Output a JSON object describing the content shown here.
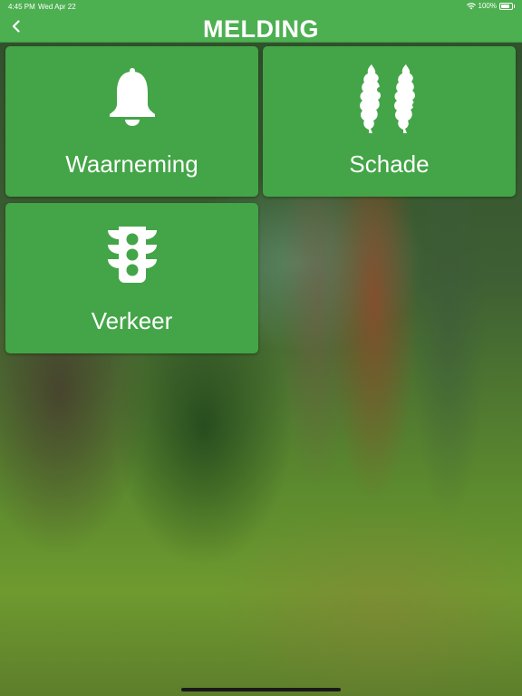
{
  "status_bar": {
    "time": "4:45 PM",
    "date": "Wed Apr 22",
    "battery": "100%",
    "battery_level": 1.0
  },
  "nav": {
    "title": "MELDING",
    "back_icon": "chevron-left-icon"
  },
  "tiles": [
    {
      "label": "Waarneming",
      "icon": "bell-icon"
    },
    {
      "label": "Schade",
      "icon": "damaged-trees-icon"
    },
    {
      "label": "Verkeer",
      "icon": "traffic-light-icon"
    }
  ],
  "colors": {
    "primary_green": "#4caf50",
    "tile_green": "#43a547",
    "text": "#ffffff"
  }
}
